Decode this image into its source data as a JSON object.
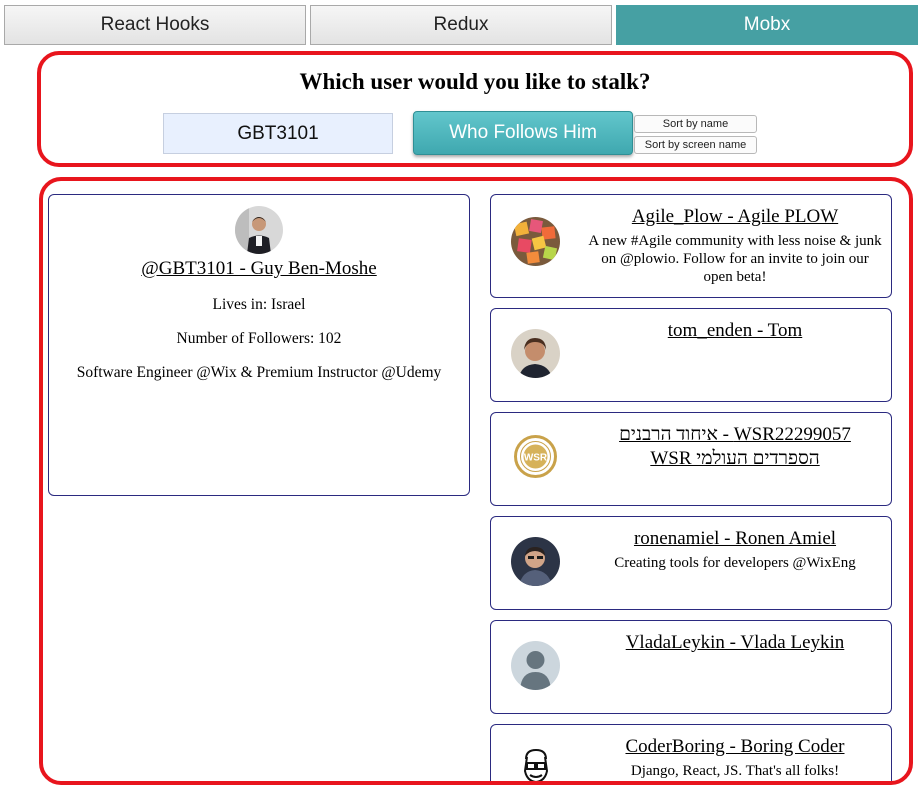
{
  "tabs": [
    {
      "label": "React Hooks",
      "active": false
    },
    {
      "label": "Redux",
      "active": false
    },
    {
      "label": "Mobx",
      "active": true
    }
  ],
  "search": {
    "title": "Which user would you like to stalk?",
    "value": "GBT3101",
    "button_label": "Who Follows Him",
    "sort_by_name": "Sort by name",
    "sort_by_screen_name": "Sort by screen name"
  },
  "profile": {
    "link": "@GBT3101 - Guy Ben-Moshe",
    "location": "Lives in: Israel",
    "followers": "Number of Followers: 102",
    "description": "Software Engineer @Wix & Premium Instructor @Udemy",
    "avatar_icon": "person-photo-icon"
  },
  "followers": [
    {
      "name": "Agile_Plow - Agile PLOW",
      "description": "A new #Agile community with less noise & junk on @plowio. Follow for an invite to join our open beta!",
      "avatar_icon": "sticky-notes-icon"
    },
    {
      "name": "tom_enden - Tom",
      "description": "",
      "avatar_icon": "person-photo-icon"
    },
    {
      "name": "WSR22299057 - איחוד הרבנים הספרדים העולמי WSR",
      "description": "",
      "avatar_icon": "wsr-seal-icon"
    },
    {
      "name": "ronenamiel - Ronen Amiel",
      "description": "Creating tools for developers @WixEng",
      "avatar_icon": "person-photo-icon"
    },
    {
      "name": "VladaLeykin - Vlada Leykin",
      "description": "",
      "avatar_icon": "default-avatar-icon"
    },
    {
      "name": "CoderBoring - Boring Coder",
      "description": "Django, React, JS. That's all folks!",
      "avatar_icon": "cartoon-coder-icon"
    }
  ],
  "colors": {
    "accent": "#46a0a3",
    "panel_border": "#e8151d",
    "card_border": "#2b2a80"
  }
}
